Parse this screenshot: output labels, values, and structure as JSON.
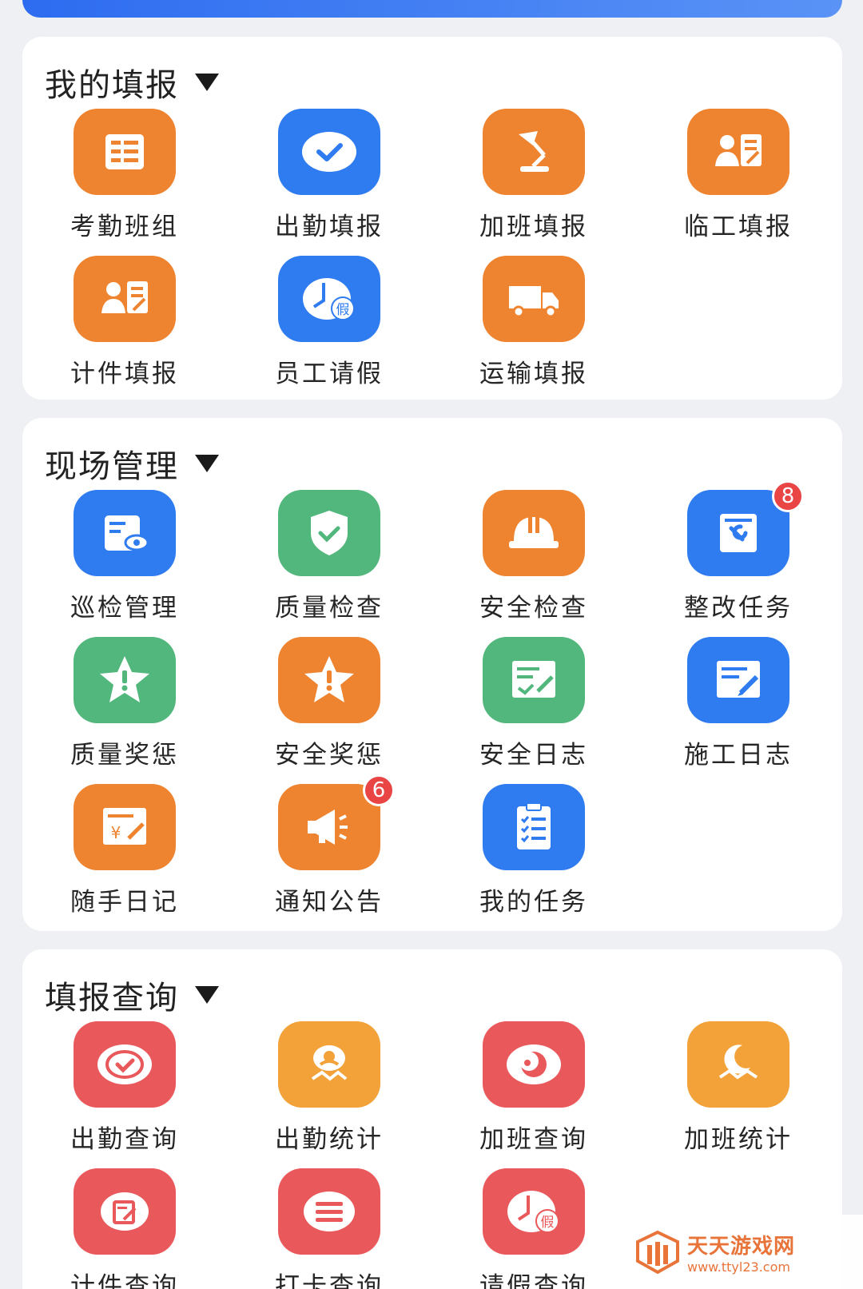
{
  "colors": {
    "orange": "#ef8430",
    "blue": "#2f7cf0",
    "green": "#52b77c",
    "red": "#e9585a",
    "amber": "#f3a23a",
    "badge": "#e94545"
  },
  "sections": [
    {
      "title": "我的填报",
      "items": [
        {
          "label": "考勤班组",
          "icon": "roster-icon"
        },
        {
          "label": "出勤填报",
          "icon": "check-circle-icon"
        },
        {
          "label": "加班填报",
          "icon": "desk-lamp-icon"
        },
        {
          "label": "临工填报",
          "icon": "worker-form-icon"
        },
        {
          "label": "计件填报",
          "icon": "worker-form-icon"
        },
        {
          "label": "员工请假",
          "icon": "clock-leave-icon"
        },
        {
          "label": "运输填报",
          "icon": "truck-icon"
        }
      ]
    },
    {
      "title": "现场管理",
      "items": [
        {
          "label": "巡检管理",
          "icon": "inspect-doc-icon"
        },
        {
          "label": "质量检查",
          "icon": "shield-check-icon"
        },
        {
          "label": "安全检查",
          "icon": "hard-hat-icon"
        },
        {
          "label": "整改任务",
          "icon": "wrench-doc-icon",
          "badge": "8"
        },
        {
          "label": "质量奖惩",
          "icon": "star-alert-icon"
        },
        {
          "label": "安全奖惩",
          "icon": "star-alert-icon"
        },
        {
          "label": "安全日志",
          "icon": "log-check-icon"
        },
        {
          "label": "施工日志",
          "icon": "log-edit-icon"
        },
        {
          "label": "随手日记",
          "icon": "yuan-note-icon"
        },
        {
          "label": "通知公告",
          "icon": "megaphone-icon",
          "badge": "6"
        },
        {
          "label": "我的任务",
          "icon": "clipboard-list-icon"
        }
      ]
    },
    {
      "title": "填报查询",
      "items": [
        {
          "label": "出勤查询",
          "icon": "check-circle-icon"
        },
        {
          "label": "出勤统计",
          "icon": "person-stat-icon"
        },
        {
          "label": "加班查询",
          "icon": "moon-circle-icon"
        },
        {
          "label": "加班统计",
          "icon": "moon-stat-icon"
        },
        {
          "label": "计件查询",
          "icon": "edit-circle-icon"
        },
        {
          "label": "打卡查询",
          "icon": "list-circle-icon"
        },
        {
          "label": "请假查询",
          "icon": "clock-leave-icon"
        }
      ]
    }
  ],
  "watermark": {
    "title": "天天游戏网",
    "url": "www.ttyl23.com"
  }
}
